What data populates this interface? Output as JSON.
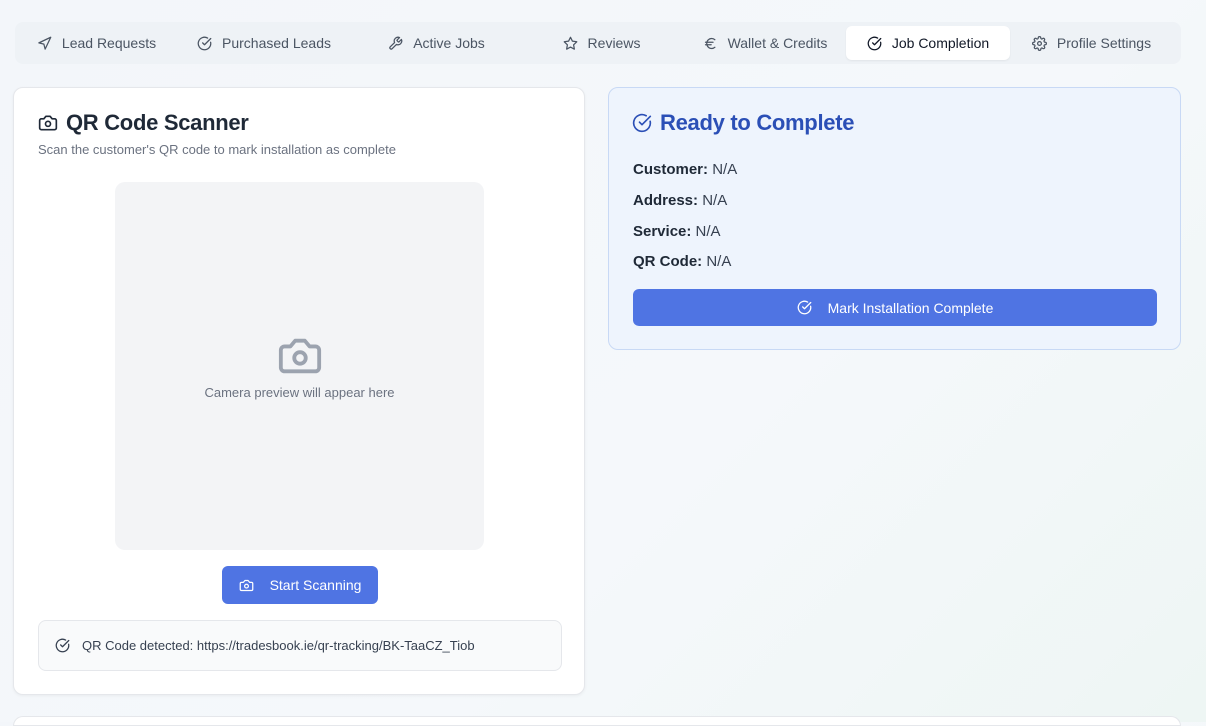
{
  "tabs": [
    {
      "label": "Lead Requests",
      "icon": "send-icon"
    },
    {
      "label": "Purchased Leads",
      "icon": "check-circle-icon"
    },
    {
      "label": "Active Jobs",
      "icon": "wrench-icon"
    },
    {
      "label": "Reviews",
      "icon": "star-icon"
    },
    {
      "label": "Wallet & Credits",
      "icon": "euro-icon"
    },
    {
      "label": "Job Completion",
      "icon": "check-circle-icon",
      "active": true
    },
    {
      "label": "Profile Settings",
      "icon": "gear-icon"
    }
  ],
  "scanner": {
    "title": "QR Code Scanner",
    "subtitle": "Scan the customer's QR code to mark installation as complete",
    "preview_text": "Camera preview will appear here",
    "start_button": "Start Scanning",
    "detected_text": "QR Code detected: https://tradesbook.ie/qr-tracking/BK-TaaCZ_Tiob"
  },
  "completion": {
    "title": "Ready to Complete",
    "customer_label": "Customer:",
    "customer_value": "N/A",
    "address_label": "Address:",
    "address_value": "N/A",
    "service_label": "Service:",
    "service_value": "N/A",
    "qr_label": "QR Code:",
    "qr_value": "N/A",
    "button": "Mark Installation Complete"
  },
  "colors": {
    "accent": "#4f74e3",
    "ready_title": "#2b4fb6",
    "ready_bg": "#eef4fd"
  }
}
